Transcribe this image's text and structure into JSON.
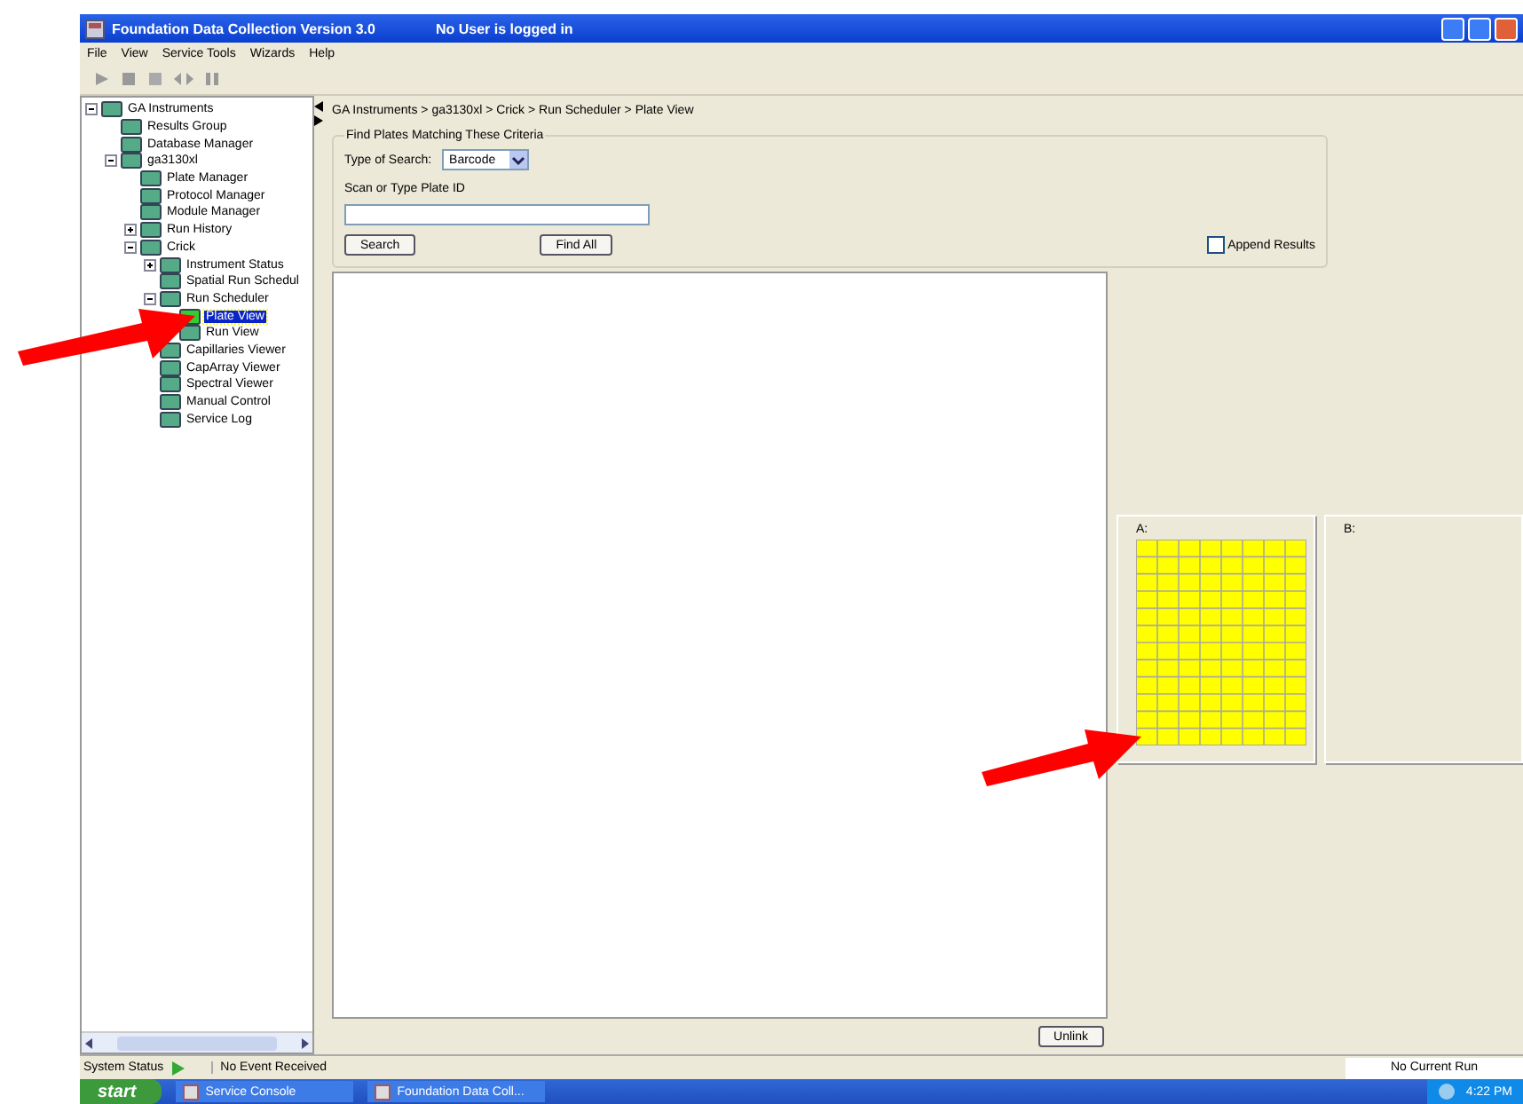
{
  "window": {
    "title": "Foundation Data Collection Version 3.0",
    "user_status": "No User is logged in"
  },
  "menu": [
    "File",
    "View",
    "Service Tools",
    "Wizards",
    "Help"
  ],
  "tree": [
    {
      "label": "GA Instruments",
      "expanded": true,
      "selected": false,
      "children": [
        {
          "label": "Results Group",
          "selected": false
        },
        {
          "label": "Database Manager",
          "selected": false
        },
        {
          "label": "ga3130xl",
          "expanded": true,
          "selected": false,
          "children": [
            {
              "label": "Plate Manager",
              "selected": false
            },
            {
              "label": "Protocol Manager",
              "selected": false
            },
            {
              "label": "Module Manager",
              "selected": false
            },
            {
              "label": "Run History",
              "expanded": false,
              "selected": false
            },
            {
              "label": "Crick",
              "expanded": true,
              "selected": false,
              "children": [
                {
                  "label": "Instrument Status",
                  "expanded": false,
                  "selected": false
                },
                {
                  "label": "Spatial Run Schedul",
                  "selected": false
                },
                {
                  "label": "Run Scheduler",
                  "expanded": true,
                  "selected": false,
                  "children": [
                    {
                      "label": "Plate View",
                      "selected": true
                    },
                    {
                      "label": "Run View",
                      "selected": false
                    }
                  ]
                },
                {
                  "label": "Capillaries Viewer",
                  "selected": false
                },
                {
                  "label": "CapArray Viewer",
                  "selected": false
                },
                {
                  "label": "Spectral Viewer",
                  "selected": false
                },
                {
                  "label": "Manual Control",
                  "selected": false
                },
                {
                  "label": "Service Log",
                  "selected": false
                }
              ]
            }
          ]
        }
      ]
    }
  ],
  "breadcrumb": "GA Instruments > ga3130xl > Crick > Run Scheduler > Plate View",
  "search_group": {
    "title": "Find Plates Matching These Criteria",
    "type_label": "Type of Search:",
    "type_value": "Barcode",
    "id_label": "Scan or Type Plate ID",
    "buttons": [
      "Search",
      "Find All"
    ],
    "append_label": "Append Results",
    "append_checked": false
  },
  "unlink_button": "Unlink",
  "plates": [
    {
      "label": "A:",
      "loaded": true
    },
    {
      "label": "B:",
      "loaded": false
    }
  ],
  "status_bar": {
    "label": "System Status",
    "event": "No Event Received",
    "run": "No Current Run"
  },
  "taskbar": {
    "start": "start",
    "tasks": [
      "Service Console",
      "Foundation Data Coll..."
    ],
    "time": "4:22 PM"
  }
}
